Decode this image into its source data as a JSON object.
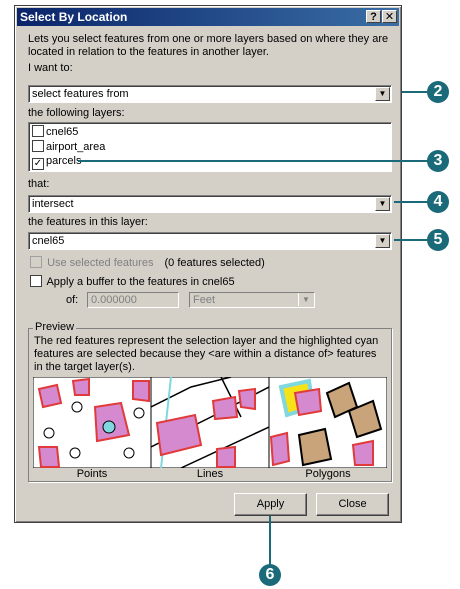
{
  "window": {
    "title": "Select By Location",
    "help_btn": "?",
    "close_btn": "✕"
  },
  "description": "Lets you select features from one or more layers based on where they are located in relation to the features in another layer.",
  "i_want_to": {
    "label": "I want to:",
    "value": "select features from"
  },
  "layers": {
    "label": "the following layers:",
    "items": [
      {
        "name": "cnel65",
        "checked": false
      },
      {
        "name": "airport_area",
        "checked": false
      },
      {
        "name": "parcels",
        "checked": true
      }
    ]
  },
  "that": {
    "label": "that:",
    "value": "intersect"
  },
  "feature_layer": {
    "label": "the features in this layer:",
    "value": "cnel65"
  },
  "use_selected": {
    "label": "Use selected features",
    "count": "(0 features selected)"
  },
  "buffer": {
    "label": "Apply a buffer to the features in  cnel65",
    "of_label": "of:",
    "distance": "0.000000",
    "units": "Feet"
  },
  "preview": {
    "title": "Preview",
    "text": "The red features represent the selection layer and the highlighted cyan features are selected because they  <are within a distance of> features in the target layer(s).",
    "labels": [
      "Points",
      "Lines",
      "Polygons"
    ]
  },
  "buttons": {
    "apply": "Apply",
    "close": "Close"
  },
  "callouts": [
    "2",
    "3",
    "4",
    "5",
    "6"
  ],
  "colors": {
    "title_bar": "#0a246a",
    "callout": "#1a6a7a",
    "selection_red": "#e03a3a",
    "feature_pink": "#d58ad0",
    "highlight_cyan": "#7fd8e0"
  }
}
